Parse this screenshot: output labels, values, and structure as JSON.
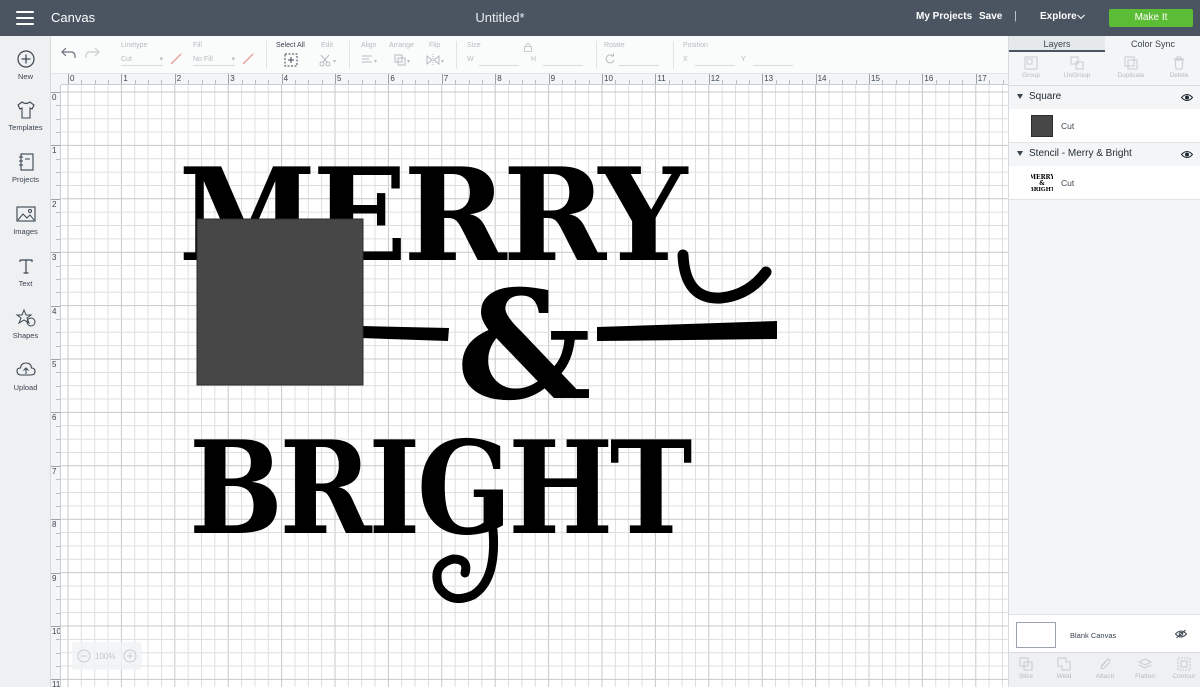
{
  "topbar": {
    "app_title": "Canvas",
    "doc_title": "Untitled*",
    "my_projects": "My Projects",
    "save": "Save",
    "separator": "|",
    "explore": "Explore",
    "make_it": "Make It"
  },
  "leftbar": {
    "items": [
      {
        "label": "New",
        "icon": "plus-circle-icon"
      },
      {
        "label": "Templates",
        "icon": "tshirt-icon"
      },
      {
        "label": "Projects",
        "icon": "notebook-icon"
      },
      {
        "label": "Images",
        "icon": "image-icon"
      },
      {
        "label": "Text",
        "icon": "text-icon"
      },
      {
        "label": "Shapes",
        "icon": "shapes-icon"
      },
      {
        "label": "Upload",
        "icon": "cloud-upload-icon"
      }
    ]
  },
  "edit_toolbar": {
    "linetype_label": "Linetype",
    "linetype_value": "Cut",
    "fill_label": "Fill",
    "fill_value": "No Fill",
    "select_all": "Select All",
    "edit": "Edit",
    "align": "Align",
    "arrange": "Arrange",
    "flip": "Flip",
    "size": "Size",
    "size_w": "W",
    "size_h": "H",
    "rotate": "Rotate",
    "position": "Position",
    "pos_x": "X",
    "pos_y": "Y"
  },
  "ruler": {
    "top_labels": [
      "0",
      "1",
      "2",
      "3",
      "4",
      "5",
      "6",
      "7",
      "8",
      "9",
      "10",
      "11",
      "12",
      "13",
      "14",
      "15",
      "16",
      "17"
    ],
    "left_labels": [
      "0",
      "1",
      "2",
      "3",
      "4",
      "5",
      "6",
      "7",
      "8",
      "9",
      "10",
      "11"
    ]
  },
  "canvas": {
    "design_top": "MERRY",
    "design_amp": "&",
    "design_bottom": "BRIGHT",
    "zoom_label": "100%",
    "square_color": "#474747"
  },
  "rightpanel": {
    "tabs": [
      "Layers",
      "Color Sync"
    ],
    "tools": [
      "Group",
      "UnGroup",
      "Duplicate",
      "Delete"
    ],
    "layers": [
      {
        "name": "Square",
        "operation": "Cut"
      },
      {
        "name": "Stencil - Merry & Bright",
        "operation": "Cut"
      }
    ],
    "blank_canvas": "Blank Canvas",
    "bottom_tools": [
      "Slice",
      "Weld",
      "Attach",
      "Flatten",
      "Contour"
    ]
  },
  "colors": {
    "topbar": "#4a5561",
    "make_it": "#5bbd35",
    "grid_minor": "#dcdfe2",
    "grid_major": "#c4c9ce"
  }
}
